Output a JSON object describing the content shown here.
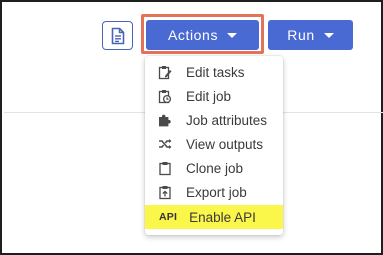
{
  "toolbar": {
    "doc_icon": "document-icon",
    "actions_label": "Actions",
    "run_label": "Run",
    "highlight_color": "#e5735a",
    "button_color": "#4a6ad3"
  },
  "menu": {
    "items": [
      {
        "label": "Edit tasks",
        "icon": "edit-tasks-icon"
      },
      {
        "label": "Edit job",
        "icon": "edit-job-icon"
      },
      {
        "label": "Job attributes",
        "icon": "puzzle-icon"
      },
      {
        "label": "View outputs",
        "icon": "shuffle-icon"
      },
      {
        "label": "Clone job",
        "icon": "clipboard-icon"
      },
      {
        "label": "Export job",
        "icon": "export-icon"
      },
      {
        "label": "Enable API",
        "icon_text": "API",
        "highlighted": true,
        "highlight_color": "#fbf64a"
      }
    ]
  }
}
